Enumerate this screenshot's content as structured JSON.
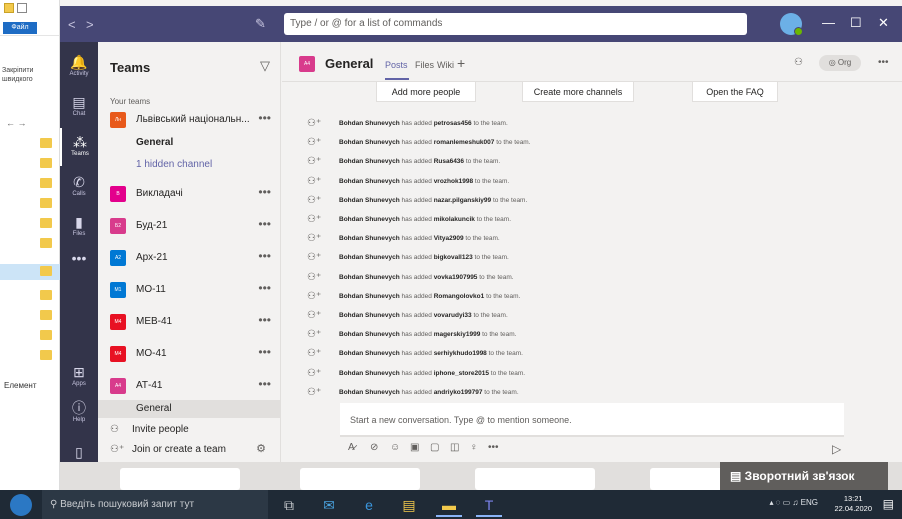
{
  "explorer": {
    "file_tab": "Файл",
    "pin_label": "Закріпити швидкого",
    "nav_arrows": "← →",
    "elements_label": "Елемент"
  },
  "titlebar": {
    "back": "<",
    "forward": ">",
    "compose_icon": "✎",
    "command_placeholder": "Type / or @ for a list of commands",
    "minimize": "—",
    "maximize": "☐",
    "close": "✕"
  },
  "rail": {
    "items": [
      {
        "label": "Activity",
        "icon": "bell-icon",
        "glyph": "🔔"
      },
      {
        "label": "Chat",
        "icon": "chat-icon",
        "glyph": "▤"
      },
      {
        "label": "Teams",
        "icon": "teams-icon",
        "glyph": "⁂"
      },
      {
        "label": "Calls",
        "icon": "phone-icon",
        "glyph": "✆"
      },
      {
        "label": "Files",
        "icon": "file-icon",
        "glyph": "▮"
      },
      {
        "label": "",
        "icon": "more-icon",
        "glyph": "•••"
      }
    ],
    "apps_label": "Apps",
    "help_label": "Help"
  },
  "teamlist": {
    "title": "Teams",
    "section": "Your teams",
    "teams": [
      {
        "badge": "Лн",
        "name": "Львівський національн...",
        "color": "#e8591a"
      },
      {
        "badge": "В",
        "name": "Викладачі",
        "color": "#e3008c"
      },
      {
        "badge": "Б2",
        "name": "Буд-21",
        "color": "#d83b8c"
      },
      {
        "badge": "А2",
        "name": "Арх-21",
        "color": "#0078d4"
      },
      {
        "badge": "М1",
        "name": "МО-11",
        "color": "#0078d4"
      },
      {
        "badge": "М4",
        "name": "МЕВ-41",
        "color": "#e81123"
      },
      {
        "badge": "М4",
        "name": "МО-41",
        "color": "#e81123"
      },
      {
        "badge": "А4",
        "name": "АТ-41",
        "color": "#d83b8c"
      }
    ],
    "general": "General",
    "hidden": "1 hidden channel",
    "general_active": "General",
    "more": "•••",
    "invite": "Invite people",
    "join": "Join or create a team"
  },
  "header": {
    "badge": "А4",
    "channel": "General",
    "tabs": [
      "Posts",
      "Files",
      "Wiki"
    ],
    "org": "Org"
  },
  "cards": {
    "add_people": "Add more people",
    "more_channels": "Create more channels",
    "faq": "Open the FAQ"
  },
  "messages": [
    {
      "actor": "Bohdan Shunevych",
      "user": "petrosas456"
    },
    {
      "actor": "Bohdan Shunevych",
      "user": "romanlemeshuk007"
    },
    {
      "actor": "Bohdan Shunevych",
      "user": "Rusa6436"
    },
    {
      "actor": "Bohdan Shunevych",
      "user": "vrozhok1998"
    },
    {
      "actor": "Bohdan Shunevych",
      "user": "nazar.pilganskiy99"
    },
    {
      "actor": "Bohdan Shunevych",
      "user": "mikolakuncik"
    },
    {
      "actor": "Bohdan Shunevych",
      "user": "Vitya2909"
    },
    {
      "actor": "Bohdan Shunevych",
      "user": "bigkovall123"
    },
    {
      "actor": "Bohdan Shunevych",
      "user": "vovka1907995"
    },
    {
      "actor": "Bohdan Shunevych",
      "user": "Romangolovko1"
    },
    {
      "actor": "Bohdan Shunevych",
      "user": "vovarudyi33"
    },
    {
      "actor": "Bohdan Shunevych",
      "user": "magerskiy1999"
    },
    {
      "actor": "Bohdan Shunevych",
      "user": "serhiykhudo1998"
    },
    {
      "actor": "Bohdan Shunevych",
      "user": "iphone_store2015"
    },
    {
      "actor": "Bohdan Shunevych",
      "user": "andriyko199797"
    }
  ],
  "message_mid": "has added",
  "message_end": "to the team.",
  "composer": {
    "placeholder": "Start a new conversation. Type @ to mention someone."
  },
  "feedback": "Зворотний зв'язок",
  "taskbar": {
    "search": "Введіть пошуковий запит тут",
    "lang": "ENG",
    "time": "13:21",
    "date": "22.04.2020"
  }
}
